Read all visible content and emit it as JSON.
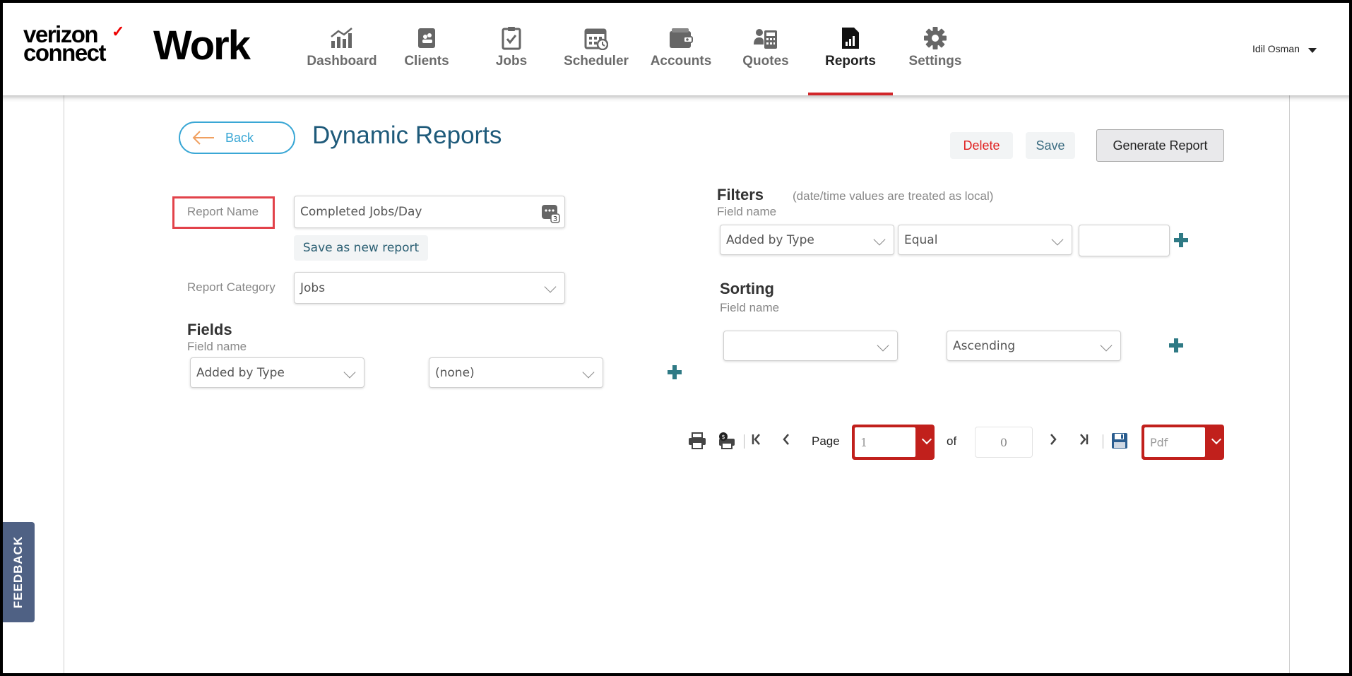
{
  "header": {
    "logo_line1": "verizon",
    "logo_line2": "connect",
    "logo_check": "✓",
    "brand": "Work",
    "nav": [
      {
        "label": "Dashboard",
        "icon": "dashboard-chart-icon"
      },
      {
        "label": "Clients",
        "icon": "clients-icon"
      },
      {
        "label": "Jobs",
        "icon": "jobs-clipboard-icon"
      },
      {
        "label": "Scheduler",
        "icon": "scheduler-calendar-icon"
      },
      {
        "label": "Accounts",
        "icon": "accounts-wallet-icon"
      },
      {
        "label": "Quotes",
        "icon": "quotes-calculator-icon"
      },
      {
        "label": "Reports",
        "icon": "reports-icon",
        "active": true
      },
      {
        "label": "Settings",
        "icon": "settings-gear-icon"
      }
    ],
    "user_name": "Idil Osman"
  },
  "page": {
    "back_label": "Back",
    "title": "Dynamic Reports",
    "delete_label": "Delete",
    "save_label": "Save",
    "generate_label": "Generate Report"
  },
  "report": {
    "name_label": "Report Name",
    "name_value": "Completed Jobs/Day",
    "save_new_label": "Save as new report",
    "category_label": "Report Category",
    "category_value": "Jobs"
  },
  "fields": {
    "heading": "Fields",
    "field_name_label": "Field name",
    "field_value": "Added by Type",
    "second_value": "(none)"
  },
  "filters": {
    "heading": "Filters",
    "note": "(date/time values are treated as local)",
    "field_name_label": "Field name",
    "field_value": "Added by Type",
    "operator_value": "Equal",
    "value_input": ""
  },
  "sorting": {
    "heading": "Sorting",
    "field_name_label": "Field name",
    "field_value": "",
    "order_value": "Ascending"
  },
  "pager": {
    "page_label": "Page",
    "page_value": "1",
    "of_label": "of",
    "total_pages": "0",
    "format_value": "Pdf"
  },
  "feedback_label": "FEEDBACK",
  "colors": {
    "accent_red": "#d2262a",
    "title_blue": "#1e5a7a",
    "back_blue": "#3aa7d5",
    "plus_teal": "#2f7a85",
    "feedback_bg": "#4f6184",
    "delete_red": "#e02020"
  }
}
